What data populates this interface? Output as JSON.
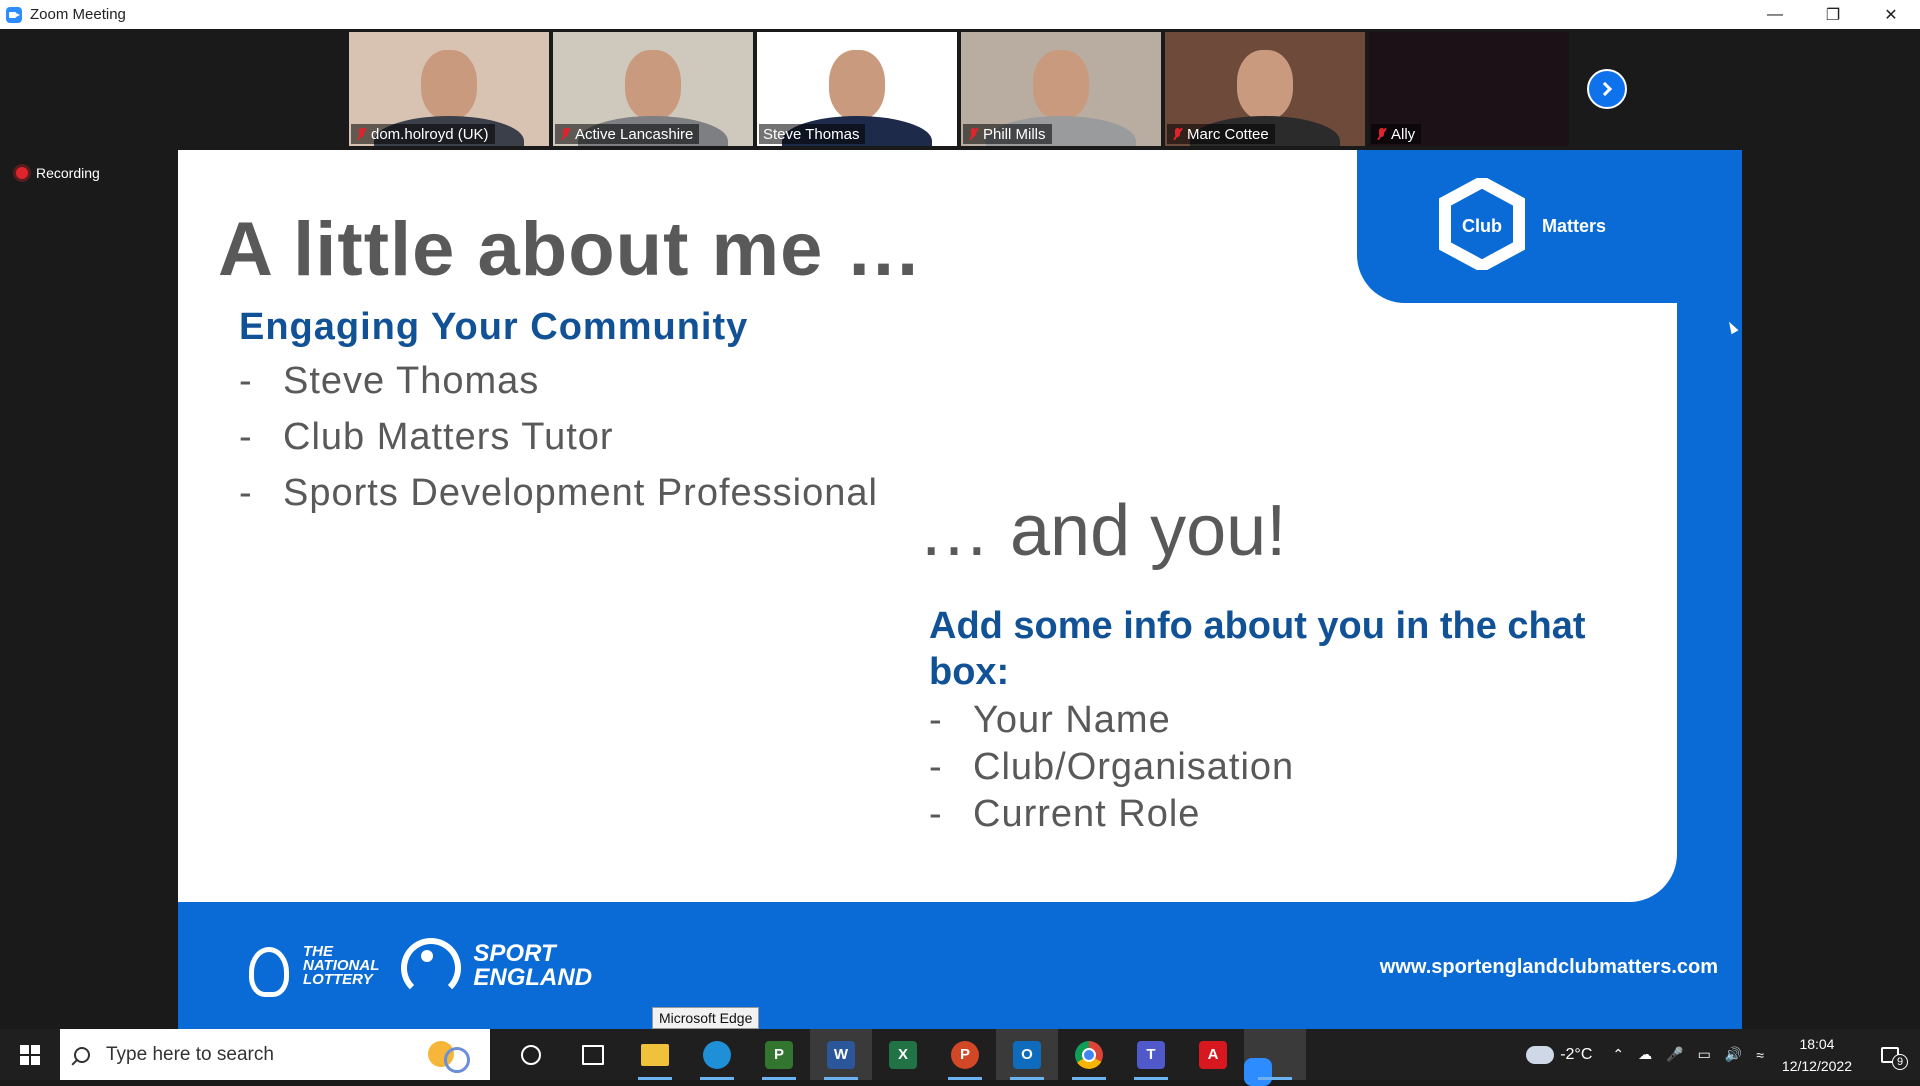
{
  "window": {
    "title": "Zoom Meeting",
    "controls": [
      "minimize-icon",
      "restore-icon",
      "close-icon"
    ]
  },
  "recording": {
    "label": "Recording"
  },
  "participants": [
    {
      "name": "dom.holroyd (UK)",
      "muted": true,
      "active": false,
      "bg": "#d8c3b2",
      "shirt": "#3a3f4a"
    },
    {
      "name": "Active Lancashire",
      "muted": true,
      "active": false,
      "bg": "#cfc8bd",
      "shirt": "#7d7f82"
    },
    {
      "name": "Steve Thomas",
      "muted": false,
      "active": true,
      "bg": "#ffffff",
      "shirt": "#1d2a4a"
    },
    {
      "name": "Phill Mills",
      "muted": true,
      "active": false,
      "bg": "#b9aca0",
      "shirt": "#9a9b9d"
    },
    {
      "name": "Marc Cottee",
      "muted": true,
      "active": false,
      "bg": "#6d4a3a",
      "shirt": "#2b2b2b"
    },
    {
      "name": "Ally",
      "muted": true,
      "active": false,
      "bg": "#1c1117",
      "shirt": ""
    }
  ],
  "slide": {
    "title": "A little about me …",
    "subheading": "Engaging Your Community",
    "bullets": [
      "Steve Thomas",
      "Club Matters Tutor",
      "Sports Development Professional"
    ],
    "and_you": "…  and you!",
    "chat_heading": "Add some info about you in the chat box:",
    "chat_bullets": [
      "Your Name",
      "Club/Organisation",
      "Current Role"
    ],
    "logo": {
      "club": "Club",
      "matters": "Matters"
    },
    "footer": {
      "lottery": [
        "THE",
        "NATIONAL",
        "LOTTERY"
      ],
      "sport_england": [
        "SPORT",
        "ENGLAND"
      ],
      "url": "www.sportenglandclubmatters.com"
    },
    "colors": {
      "brand_blue": "#0a6bd6",
      "heading_blue": "#115196",
      "text_grey": "#595959"
    }
  },
  "tooltip": {
    "text": "Microsoft Edge"
  },
  "taskbar": {
    "search_placeholder": "Type here to search",
    "apps": [
      "cortana-icon",
      "task-view-icon",
      "file-explorer-icon",
      "edge-icon",
      "project-icon",
      "word-icon",
      "excel-icon",
      "powerpoint-icon",
      "outlook-icon",
      "chrome-icon",
      "teams-icon",
      "acrobat-icon",
      "zoom-icon"
    ],
    "weather": "-2°C",
    "time": "18:04",
    "date": "12/12/2022",
    "notification_count": "9"
  }
}
